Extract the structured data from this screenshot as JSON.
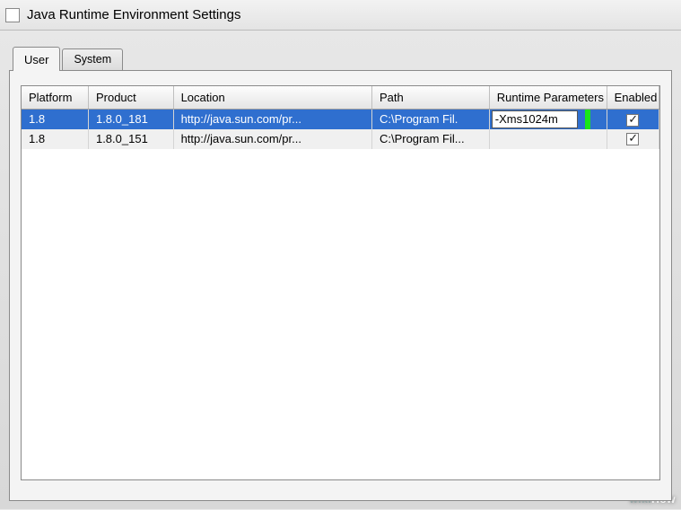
{
  "window": {
    "title": "Java Runtime Environment Settings"
  },
  "tabs": {
    "user": "User",
    "system": "System"
  },
  "columns": {
    "platform": "Platform",
    "product": "Product",
    "location": "Location",
    "path": "Path",
    "runtime": "Runtime Parameters",
    "enabled": "Enabled"
  },
  "rows": [
    {
      "platform": "1.8",
      "product": "1.8.0_181",
      "location": "http://java.sun.com/pr...",
      "path": "C:\\Program Fil.",
      "runtime": "-Xms1024m",
      "enabled": true,
      "selected": true,
      "editing": true
    },
    {
      "platform": "1.8",
      "product": "1.8.0_151",
      "location": "http://java.sun.com/pr...",
      "path": "C:\\Program Fil...",
      "runtime": "",
      "enabled": true,
      "selected": false,
      "editing": false
    }
  ],
  "watermark": {
    "a": "wiki",
    "b": "How"
  }
}
